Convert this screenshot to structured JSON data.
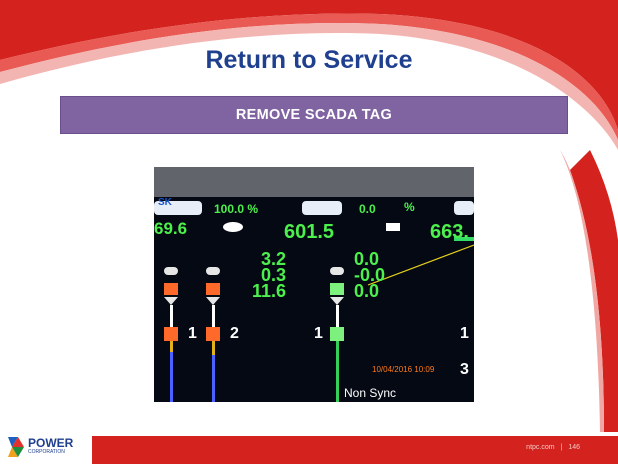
{
  "slide": {
    "title": "Return to Service",
    "banner": "REMOVE SCADA TAG",
    "footer_site": "ntpc.com",
    "footer_sep": "|",
    "page_number": "146",
    "logo_text_main": "POWER",
    "logo_text_sub": "CORPORATION"
  },
  "screen": {
    "percent_left": "100.0 %",
    "percent_mid": "0.0",
    "percent_sign": "%",
    "left_value": "69.6",
    "mid_value": "601.5",
    "right_value": "663.",
    "readings_col1": [
      "3.2",
      "0.3",
      "11.6"
    ],
    "readings_col2": [
      "0.0",
      "-0.0",
      "0.0"
    ],
    "bay_label_1": "1",
    "bay_label_2": "2",
    "bay_label_3": "1",
    "bay_label_4": "1",
    "bay_label_5": "3",
    "timestamp": "10/04/2016 10:09",
    "sync_status": "Non Sync"
  },
  "colors": {
    "title_blue": "#1f3f8f",
    "banner_purple": "#8064a2",
    "footer_red": "#d4231e",
    "screen_green": "#5cff5c",
    "screen_orange": "#ff6a2a"
  }
}
